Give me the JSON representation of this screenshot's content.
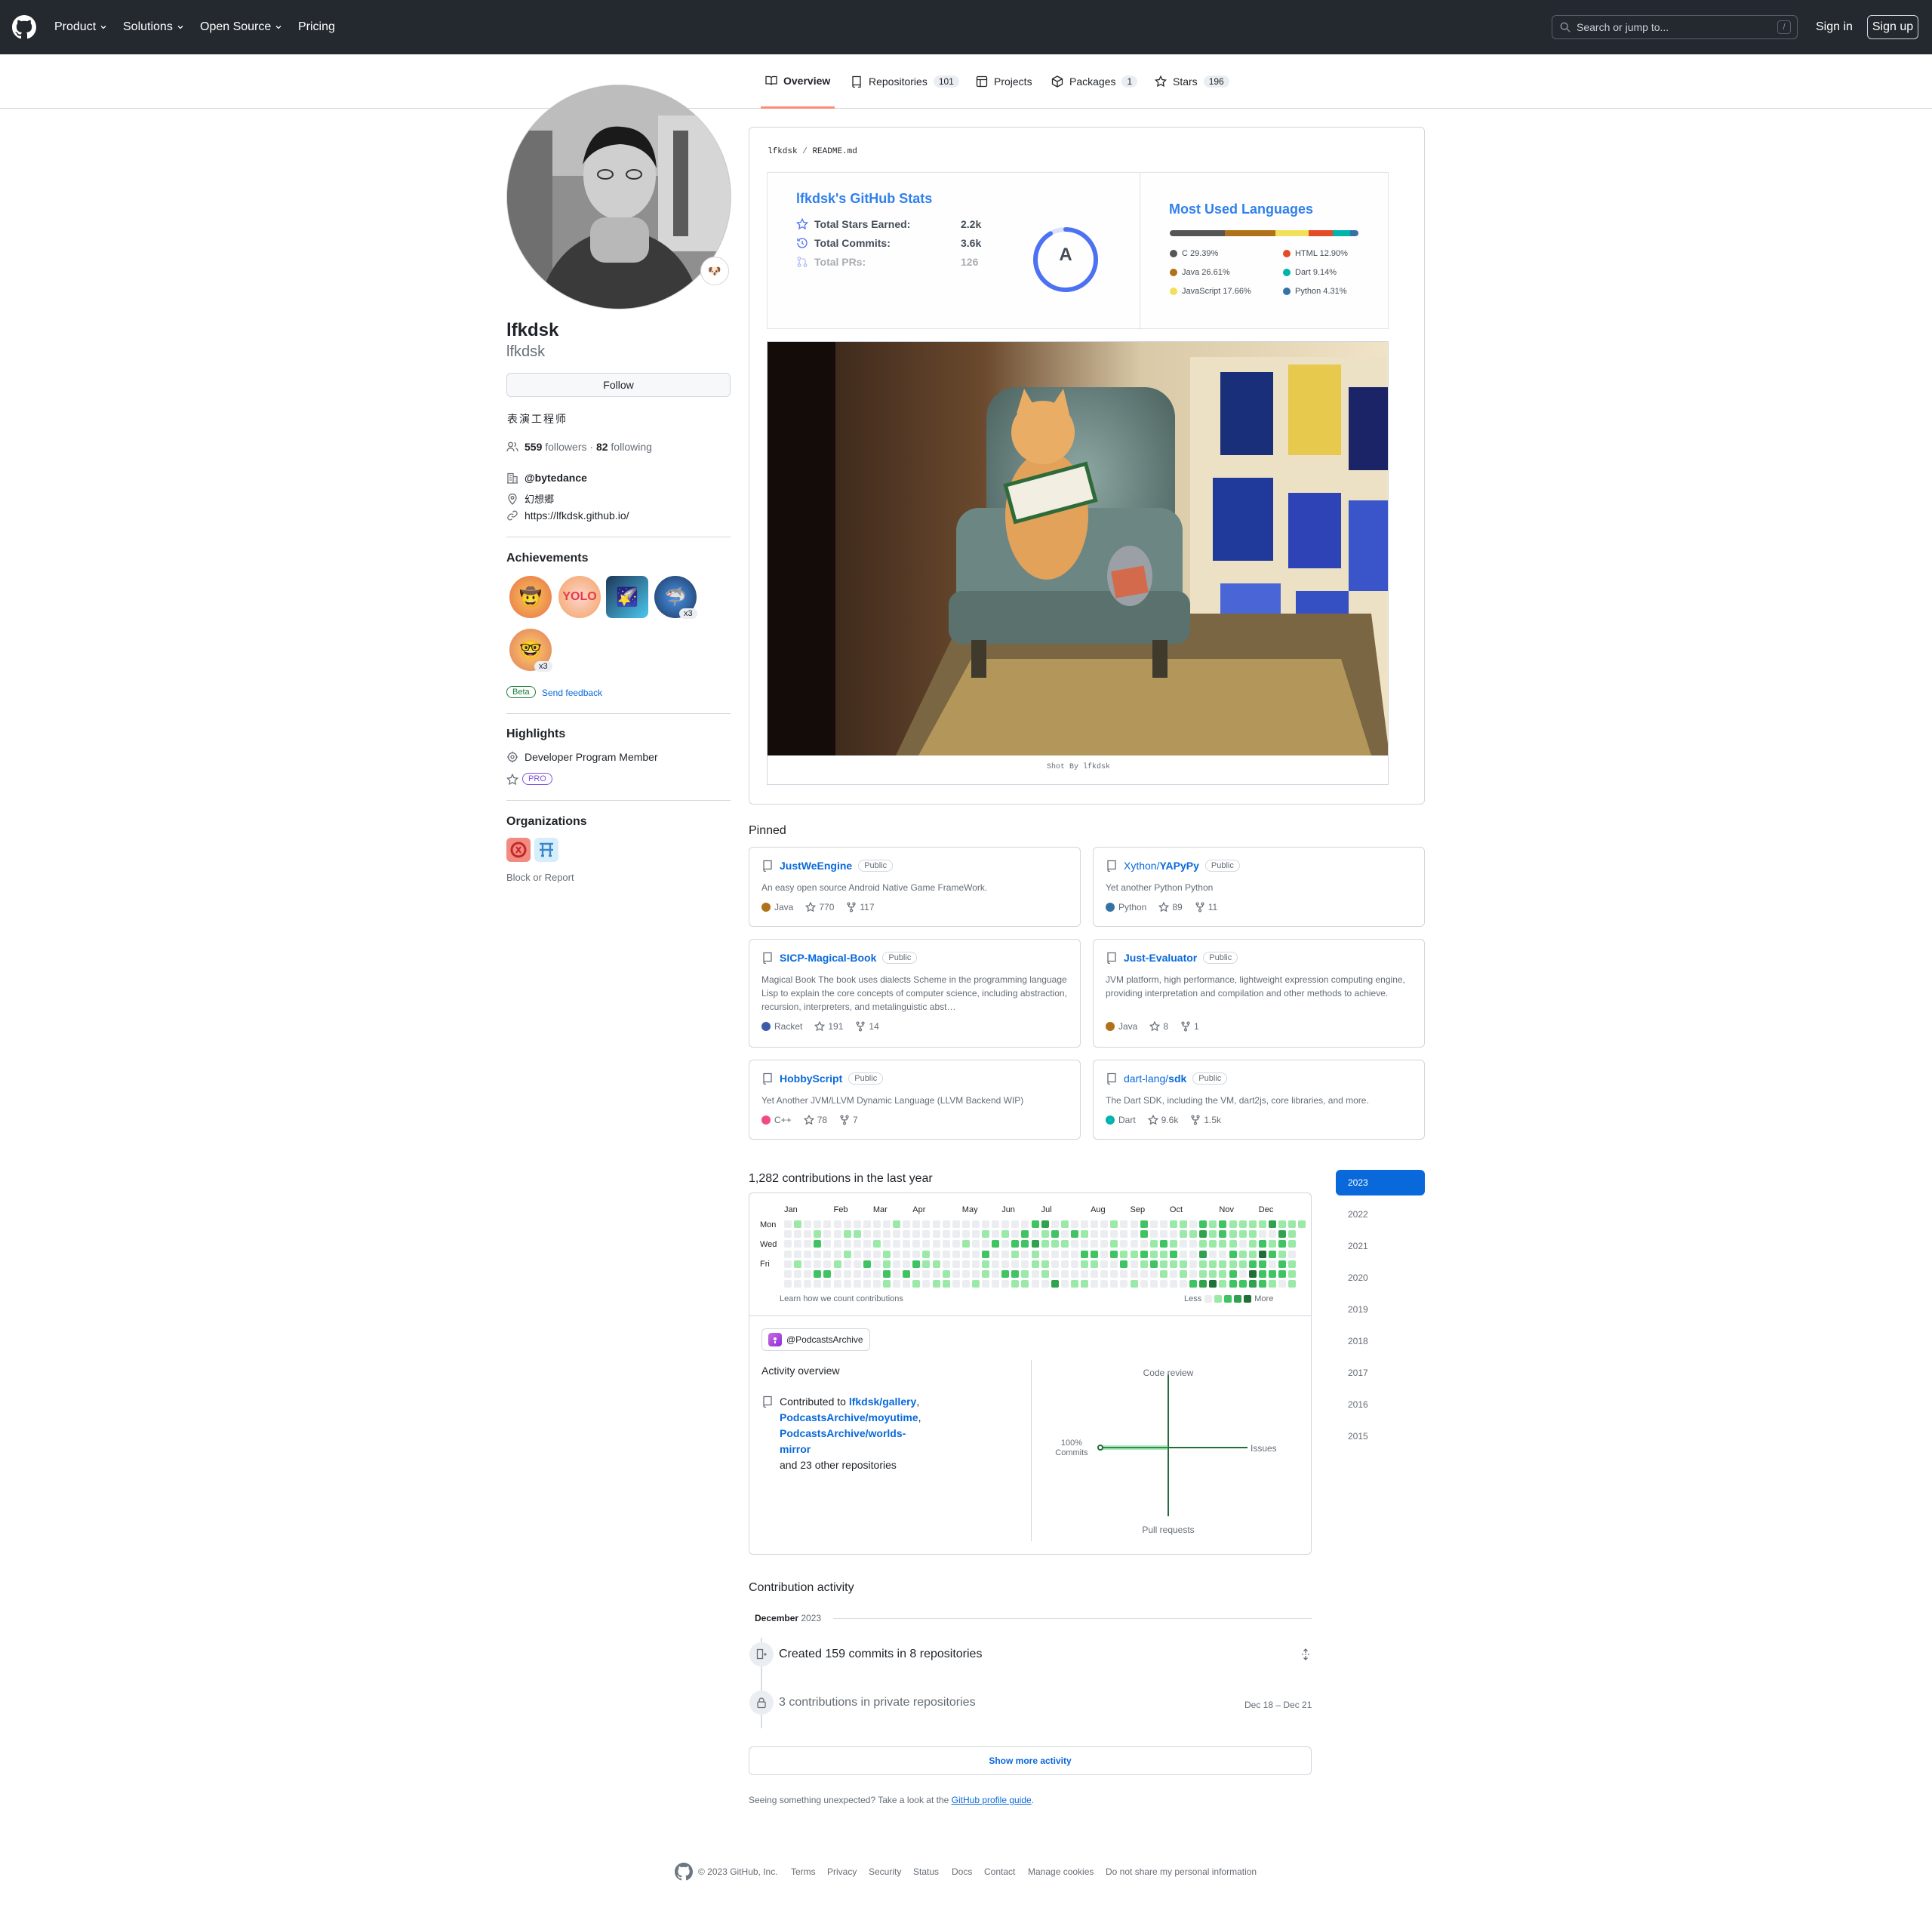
{
  "header": {
    "nav": [
      {
        "label": "Product",
        "dropdown": true
      },
      {
        "label": "Solutions",
        "dropdown": true
      },
      {
        "label": "Open Source",
        "dropdown": true
      },
      {
        "label": "Pricing",
        "dropdown": false
      }
    ],
    "search_placeholder": "Search or jump to...",
    "search_key": "/",
    "sign_in": "Sign in",
    "sign_up": "Sign up"
  },
  "tabs": [
    {
      "label": "Overview",
      "icon": "book-icon",
      "count": "",
      "selected": true
    },
    {
      "label": "Repositories",
      "icon": "repo-icon",
      "count": "101",
      "selected": false
    },
    {
      "label": "Projects",
      "icon": "table-icon",
      "count": "",
      "selected": false
    },
    {
      "label": "Packages",
      "icon": "package-icon",
      "count": "1",
      "selected": false
    },
    {
      "label": "Stars",
      "icon": "star-icon",
      "count": "196",
      "selected": false
    }
  ],
  "profile": {
    "name": "lfkdsk",
    "login": "lfkdsk",
    "status_emoji": "🐶",
    "follow_label": "Follow",
    "bio": "表演工程师",
    "followers_count": "559",
    "followers_label": "followers",
    "sep": "·",
    "following_count": "82",
    "following_label": "following",
    "company": "@bytedance",
    "location": "幻想郷",
    "website": "https://lfkdsk.github.io/"
  },
  "achievements": {
    "title": "Achievements",
    "badges": [
      {
        "emoji": "🤠",
        "count": ""
      },
      {
        "emoji": "YOLO",
        "count": ""
      },
      {
        "emoji": "🌠",
        "count": ""
      },
      {
        "emoji": "🦈",
        "count": "x3"
      },
      {
        "emoji": "🤓",
        "count": "x3"
      }
    ],
    "beta": "Beta",
    "feedback": "Send feedback"
  },
  "highlights": {
    "title": "Highlights",
    "items": [
      "Developer Program Member"
    ],
    "pro": "PRO"
  },
  "organizations": {
    "title": "Organizations",
    "block": "Block or Report"
  },
  "readme": {
    "path_user": "lfkdsk",
    "path_sep": "/",
    "path_file": "README.md",
    "stats": {
      "title": "lfkdsk's GitHub Stats",
      "rows": [
        {
          "label": "Total Stars Earned:",
          "value": "2.2k"
        },
        {
          "label": "Total Commits:",
          "value": "3.6k"
        },
        {
          "label": "Total PRs:",
          "value": "126"
        }
      ],
      "grade": "A"
    },
    "languages": {
      "title": "Most Used Languages",
      "items": [
        {
          "name": "C 29.39%",
          "color": "#555555",
          "pct": 29.39
        },
        {
          "name": "Java 26.61%",
          "color": "#b07219",
          "pct": 26.61
        },
        {
          "name": "JavaScript 17.66%",
          "color": "#f1e05a",
          "pct": 17.66
        },
        {
          "name": "HTML 12.90%",
          "color": "#e34c26",
          "pct": 12.9
        },
        {
          "name": "Dart 9.14%",
          "color": "#00b4ab",
          "pct": 9.14
        },
        {
          "name": "Python 4.31%",
          "color": "#3572a5",
          "pct": 4.31
        }
      ]
    },
    "photo_caption": "Shot By lfkdsk"
  },
  "pinned": {
    "title": "Pinned",
    "public_label": "Public",
    "repos": [
      {
        "owner": "",
        "name": "JustWeEngine",
        "desc": "An easy open source Android Native Game FrameWork.",
        "lang": "Java",
        "color": "#b07219",
        "stars": "770",
        "forks": "117"
      },
      {
        "owner": "Xython/",
        "name": "YAPyPy",
        "desc": "Yet another Python Python",
        "lang": "Python",
        "color": "#3572a5",
        "stars": "89",
        "forks": "11"
      },
      {
        "owner": "",
        "name": "SICP-Magical-Book",
        "desc": "Magical Book The book uses dialects Scheme in the programming language Lisp to explain the core concepts of computer science, including abstraction, recursion, interpreters, and metalinguistic abst…",
        "lang": "Racket",
        "color": "#3c5caa",
        "stars": "191",
        "forks": "14"
      },
      {
        "owner": "",
        "name": "Just-Evaluator",
        "desc": "JVM platform, high performance, lightweight expression computing engine, providing interpretation and compilation and other methods to achieve.",
        "lang": "Java",
        "color": "#b07219",
        "stars": "8",
        "forks": "1"
      },
      {
        "owner": "",
        "name": "HobbyScript",
        "desc": "Yet Another JVM/LLVM Dynamic Language (LLVM Backend WIP)",
        "lang": "C++",
        "color": "#f34b7d",
        "stars": "78",
        "forks": "7"
      },
      {
        "owner": "dart-lang/",
        "name": "sdk",
        "desc": "The Dart SDK, including the VM, dart2js, core libraries, and more.",
        "lang": "Dart",
        "color": "#00b4ab",
        "stars": "9.6k",
        "forks": "1.5k"
      }
    ]
  },
  "contributions": {
    "title": "1,282 contributions in the last year",
    "months": [
      "Jan",
      "Feb",
      "Mar",
      "Apr",
      "May",
      "Jun",
      "Jul",
      "Aug",
      "Sep",
      "Oct",
      "Nov",
      "Dec"
    ],
    "days": [
      "Mon",
      "Wed",
      "Fri"
    ],
    "learn": "Learn how we count contributions",
    "less": "Less",
    "more": "More",
    "colors": [
      "#ebedf0",
      "#9be9a8",
      "#40c463",
      "#30a14e",
      "#216e39"
    ],
    "years": [
      "2023",
      "2022",
      "2021",
      "2020",
      "2019",
      "2018",
      "2017",
      "2016",
      "2015"
    ]
  },
  "activity_overview": {
    "org_label": "@PodcastsArchive",
    "title": "Activity overview",
    "contributed_to": "Contributed to",
    "repo1": "lfkdsk/gallery",
    "repo2": "PodcastsArchive/moyutime",
    "repo3": "PodcastsArchive/worlds-mirror",
    "others": "and 23 other repositories",
    "axes": {
      "top": "Code review",
      "right": "Issues",
      "bottom": "Pull requests",
      "left_pct": "100%",
      "left": "Commits"
    }
  },
  "contribution_activity": {
    "title": "Contribution activity",
    "month": "December",
    "year": "2023",
    "commits": "Created 159 commits in 8 repositories",
    "private": "3 contributions in private repositories",
    "private_dates": "Dec 18 – Dec 21",
    "show_more": "Show more activity",
    "note_prefix": "Seeing something unexpected? Take a look at the",
    "note_link": "GitHub profile guide",
    "note_suffix": "."
  },
  "footer": {
    "copyright": "© 2023 GitHub, Inc.",
    "links": [
      "Terms",
      "Privacy",
      "Security",
      "Status",
      "Docs",
      "Contact",
      "Manage cookies",
      "Do not share my personal information"
    ]
  }
}
